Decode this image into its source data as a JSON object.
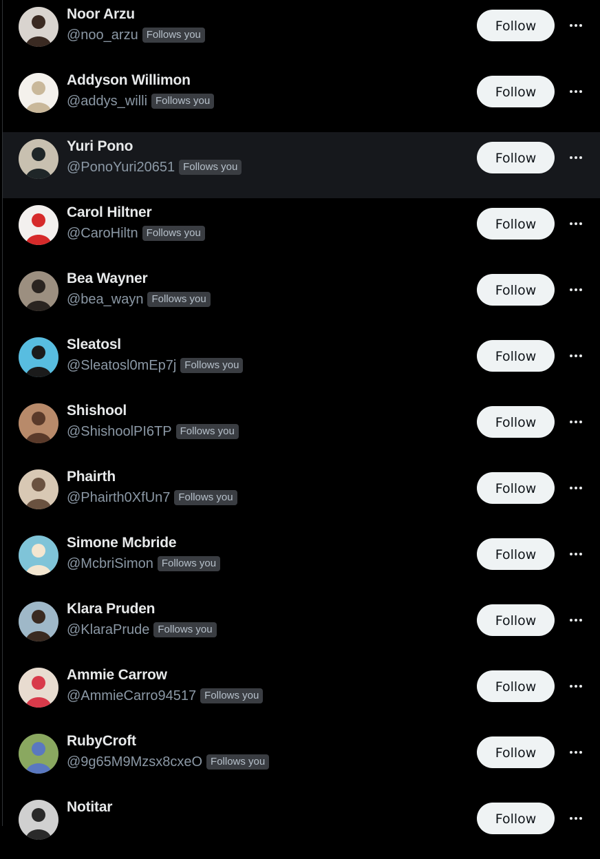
{
  "follow_label": "Follow",
  "follows_you_label": "Follows you",
  "users": [
    {
      "name": "Noor Arzu",
      "handle": "@noo_arzu",
      "follows_you": true,
      "avatar_bg": "#d9d4cf",
      "avatar_fg": "#3a2a22"
    },
    {
      "name": "Addyson Willimon",
      "handle": "@addys_willi",
      "follows_you": true,
      "avatar_bg": "#f4f1ec",
      "avatar_fg": "#c9b89a"
    },
    {
      "name": "Yuri Pono",
      "handle": "@PonoYuri20651",
      "follows_you": true,
      "avatar_bg": "#c8c0b0",
      "avatar_fg": "#1f2628"
    },
    {
      "name": "Carol Hiltner",
      "handle": "@CaroHiltn",
      "follows_you": true,
      "avatar_bg": "#f3f0ee",
      "avatar_fg": "#d62a2a"
    },
    {
      "name": "Bea Wayner",
      "handle": "@bea_wayn",
      "follows_you": true,
      "avatar_bg": "#9c8f80",
      "avatar_fg": "#2a2420"
    },
    {
      "name": "Sleatosl",
      "handle": "@Sleatosl0mEp7j",
      "follows_you": true,
      "avatar_bg": "#58bde0",
      "avatar_fg": "#1b1b1b"
    },
    {
      "name": "Shishool",
      "handle": "@ShishoolPI6TP",
      "follows_you": true,
      "avatar_bg": "#b88a6a",
      "avatar_fg": "#5a3a2a"
    },
    {
      "name": "Phairth",
      "handle": "@Phairth0XfUn7",
      "follows_you": true,
      "avatar_bg": "#d8c8b4",
      "avatar_fg": "#6a5240"
    },
    {
      "name": "Simone Mcbride",
      "handle": "@McbriSimon",
      "follows_you": true,
      "avatar_bg": "#7fc4d8",
      "avatar_fg": "#f3e6d0"
    },
    {
      "name": "Klara Pruden",
      "handle": "@KlaraPrude",
      "follows_you": true,
      "avatar_bg": "#9fb8c8",
      "avatar_fg": "#3a2a20"
    },
    {
      "name": "Ammie Carrow",
      "handle": "@AmmieCarro94517",
      "follows_you": true,
      "avatar_bg": "#e8dcd0",
      "avatar_fg": "#d83a4a"
    },
    {
      "name": "RubyCroft",
      "handle": "@9g65M9Mzsx8cxeO",
      "follows_you": true,
      "avatar_bg": "#8aa860",
      "avatar_fg": "#5a78c0"
    },
    {
      "name": "Notitar",
      "handle": "",
      "follows_you": false,
      "avatar_bg": "#d0d0d0",
      "avatar_fg": "#2a2a2a"
    }
  ]
}
